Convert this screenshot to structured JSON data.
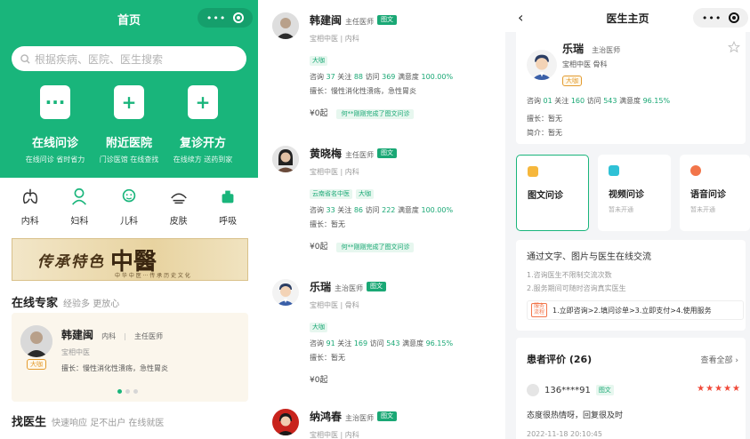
{
  "home": {
    "title": "首页",
    "search_placeholder": "根据疾病、医院、医生搜索",
    "features": [
      {
        "icon": "chat-bubble-icon",
        "title": "在线问诊",
        "sub": "在线问诊 省时省力"
      },
      {
        "icon": "hospital-icon",
        "title": "附近医院",
        "sub": "门诊医馆 在线查找"
      },
      {
        "icon": "medicine-bottle-icon",
        "title": "复诊开方",
        "sub": "在线续方 送药到家"
      }
    ],
    "departments": [
      {
        "icon": "lungs-icon",
        "label": "内科"
      },
      {
        "icon": "woman-icon",
        "label": "妇科"
      },
      {
        "icon": "baby-icon",
        "label": "儿科"
      },
      {
        "icon": "skin-icon",
        "label": "皮肤"
      },
      {
        "icon": "respiratory-icon",
        "label": "呼吸"
      }
    ],
    "banner": {
      "text": "传承特色",
      "big": "中醫",
      "sub": "中 华 中 医 ··· 传 承 历 史 文 化"
    },
    "experts_heading": "在线专家",
    "experts_sub": "经验多 更放心",
    "expert": {
      "name": "韩建闽",
      "dept": "内科",
      "title": "主任医师",
      "hospital": "宝相中医",
      "badge": "大咖",
      "specialty": "擅长：慢性消化性溃疡，急性胃炎"
    },
    "find_heading": "找医生",
    "find_sub": "快速响应 足不出户 在线就医"
  },
  "list": {
    "doctors": [
      {
        "name": "韩建闽",
        "title": "主任医师",
        "tag": "图文",
        "hospital": "宝相中医 | 内科",
        "labels": [
          "大咖"
        ],
        "consult": "37",
        "follow": "88",
        "visit": "369",
        "satisfaction": "100.00%",
        "specialty": "擅长：慢性消化性溃疡，急性胃炎",
        "price": "¥0",
        "price_unit": "起",
        "notice": "何**刚刚完成了图文问诊"
      },
      {
        "name": "黄晓梅",
        "title": "主任医师",
        "tag": "图文",
        "hospital": "宝相中医 | 内科",
        "labels": [
          "云南省名中医",
          "大咖"
        ],
        "consult": "33",
        "follow": "86",
        "visit": "222",
        "satisfaction": "100.00%",
        "specialty": "擅长：暂无",
        "price": "¥0",
        "price_unit": "起",
        "notice": "何**刚刚完成了图文问诊"
      },
      {
        "name": "乐瑞",
        "title": "主治医师",
        "tag": "图文",
        "hospital": "宝相中医 | 骨科",
        "labels": [
          "大咖"
        ],
        "consult": "91",
        "follow": "169",
        "visit": "543",
        "satisfaction": "96.15%",
        "specialty": "擅长：暂无",
        "price": "¥0",
        "price_unit": "起",
        "notice": ""
      },
      {
        "name": "纳鸿春",
        "title": "主治医师",
        "tag": "图文",
        "hospital": "宝相中医 | 内科",
        "labels": [],
        "consult": "",
        "follow": "",
        "visit": "",
        "satisfaction": "",
        "specialty": "",
        "price": "",
        "price_unit": "",
        "notice": ""
      }
    ],
    "stat_labels": {
      "consult": "咨询",
      "follow": "关注",
      "visit": "访问",
      "satisfaction": "满意度"
    }
  },
  "detail": {
    "title": "医生主页",
    "name": "乐瑞",
    "title_rank": "主治医师",
    "hospital": "宝相中医",
    "dept": "骨科",
    "badge": "大咖",
    "stats": {
      "consult": "01",
      "follow": "160",
      "visit": "543",
      "satisfaction": "96.15%"
    },
    "specialty": "擅长：暂无",
    "intro": "简介：暂无",
    "tabs": [
      {
        "icon": "image-text-icon",
        "label": "图文问诊",
        "sub": "",
        "color": "#f6b73c"
      },
      {
        "icon": "video-icon",
        "label": "视频问诊",
        "sub": "暂未开通",
        "color": "#2fc1d6"
      },
      {
        "icon": "voice-icon",
        "label": "语音问诊",
        "sub": "暂未开通",
        "color": "#f2754a"
      }
    ],
    "desc": "通过文字、图片与医生在线交流",
    "rules": [
      "1.咨询医生不限制交流次数",
      "2.服务期间可随时咨询真实医生"
    ],
    "flow_label": "服务流程",
    "flow": "1.立即咨询>2.填问诊单>3.立即支付>4.使用服务",
    "review_heading": "患者评价 (26)",
    "review_all": "查看全部",
    "review_user": "136****91",
    "review_tag": "图文",
    "review_text": "态度很热情呀，回复很及时",
    "review_date": "2022-11-18 20:10:45"
  },
  "colors": {
    "brand": "#19b57b",
    "star": "#f04a3a",
    "badge": "#e39b2f"
  }
}
